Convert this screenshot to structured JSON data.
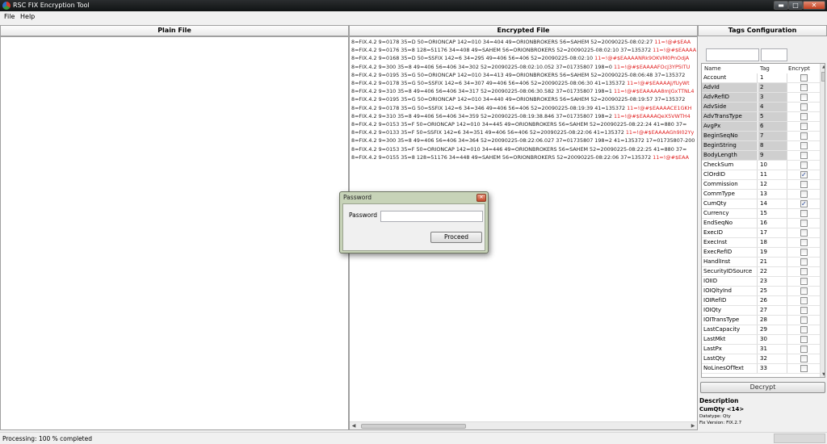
{
  "window": {
    "title": "RSC FIX Encryption Tool",
    "minimize_glyph": "▬",
    "maximize_glyph": "□",
    "close_glyph": "✕"
  },
  "menu": {
    "items": [
      "File",
      "Help"
    ]
  },
  "panels": {
    "plain_file": "Plain File",
    "encrypted_file": "Encrypted File",
    "tags_configuration": "Tags Configuration"
  },
  "encrypted_lines": [
    {
      "plain": "8=FIX.4.2 9=0178 35=D 50=ORIONCAP 142=010 34=404 49=ORIONBROKERS 56=SAHEM 52=20090225-08:02:27 ",
      "cipher": "11=!@#$EAA"
    },
    {
      "plain": "8=FIX.4.2 9=0176 35=8 128=51176 34=408 49=SAHEM 56=ORIONBROKERS 52=20090225-08:02:10 37=135372 ",
      "cipher": "11=!@#$EAAAA"
    },
    {
      "plain": "8=FIX.4.2 9=0168 35=D 50=SSFIX 142=6 34=295 49=406 56=406 52=20090225-08:02:10 ",
      "cipher": "11=!@#$EAAAANRk9OKVM0PnOdjA"
    },
    {
      "plain": "8=FIX.4.2 9=300 35=8 49=406 56=406 34=302 52=20090225-08:02:10.052 37=01735807 198=0 ",
      "cipher": "11=!@#$EAAAAFOcJ3YP5ITU"
    },
    {
      "plain": "8=FIX.4.2 9=0195 35=G 50=ORIONCAP 142=010 34=413 49=ORIONBROKERS 56=SAHEM 52=20090225-08:06:48 37=135372 ",
      "cipher": ""
    },
    {
      "plain": "8=FIX.4.2 9=0178 35=G 50=SSFIX 142=6 34=307 49=406 56=406 52=20090225-08:06:30 41=135372 ",
      "cipher": "11=!@#$EAAAAJ/fUyWt"
    },
    {
      "plain": "8=FIX.4.2 9=310 35=8 49=406 56=406 34=317 52=20090225-08:06:30.582 37=01735807 198=1 ",
      "cipher": "11=!@#$EAAAAA8mJGxTTNL4"
    },
    {
      "plain": "8=FIX.4.2 9=0195 35=G 50=ORIONCAP 142=010 34=440 49=ORIONBROKERS 56=SAHEM 52=20090225-08:19:57 37=135372 ",
      "cipher": ""
    },
    {
      "plain": "8=FIX.4.2 9=0178 35=G 50=SSFIX 142=6 34=346 49=406 56=406 52=20090225-08:19:39 41=135372 ",
      "cipher": "11=!@#$EAAAACE1GKH"
    },
    {
      "plain": "8=FIX.4.2 9=310 35=8 49=406 56=406 34=359 52=20090225-08:19:38.846 37=01735807 198=2 ",
      "cipher": "11=!@#$EAAAAQeX5VWTH4"
    },
    {
      "plain": "8=FIX.4.2 9=0153 35=F 50=ORIONCAP 142=010 34=445 49=ORIONBROKERS 56=SAHEM 52=20090225-08:22:24 41=880 37=",
      "cipher": ""
    },
    {
      "plain": "8=FIX.4.2 9=0133 35=F 50=SSFIX 142=6 34=351 49=406 56=406 52=20090225-08:22:06 41=135372 ",
      "cipher": "11=!@#$EAAAAGh9l02Yy"
    },
    {
      "plain": "8=FIX.4.2 9=300 35=8 49=406 56=406 34=364 52=20090225-08:22:06.027 37=01735807 198=2 41=135372 17=01735807-200",
      "cipher": ""
    },
    {
      "plain": "8=FIX.4.2 9=0153 35=F 50=ORIONCAP 142=010 34=446 49=ORIONBROKERS 56=SAHEM 52=20090225-08:22:25 41=880 37=",
      "cipher": ""
    },
    {
      "plain": "8=FIX.4.2 9=0155 35=8 128=51176 34=448 49=SAHEM 56=ORIONBROKERS 52=20090225-08:22:06 37=135372 ",
      "cipher": "11=!@#$EAA"
    }
  ],
  "tags_grid": {
    "headers": {
      "name": "Name",
      "tag": "Tag",
      "encrypt": "Encrypt"
    },
    "rows": [
      {
        "name": "Account",
        "tag": "1",
        "encrypt": false,
        "shaded": false
      },
      {
        "name": "AdvId",
        "tag": "2",
        "encrypt": false,
        "shaded": true
      },
      {
        "name": "AdvRefID",
        "tag": "3",
        "encrypt": false,
        "shaded": true
      },
      {
        "name": "AdvSide",
        "tag": "4",
        "encrypt": false,
        "shaded": true
      },
      {
        "name": "AdvTransType",
        "tag": "5",
        "encrypt": false,
        "shaded": true
      },
      {
        "name": "AvgPx",
        "tag": "6",
        "encrypt": false,
        "shaded": true
      },
      {
        "name": "BeginSeqNo",
        "tag": "7",
        "encrypt": false,
        "shaded": true
      },
      {
        "name": "BeginString",
        "tag": "8",
        "encrypt": false,
        "shaded": true
      },
      {
        "name": "BodyLength",
        "tag": "9",
        "encrypt": false,
        "shaded": true
      },
      {
        "name": "CheckSum",
        "tag": "10",
        "encrypt": false,
        "shaded": false
      },
      {
        "name": "ClOrdID",
        "tag": "11",
        "encrypt": true,
        "shaded": false
      },
      {
        "name": "Commission",
        "tag": "12",
        "encrypt": false,
        "shaded": false
      },
      {
        "name": "CommType",
        "tag": "13",
        "encrypt": false,
        "shaded": false
      },
      {
        "name": "CumQty",
        "tag": "14",
        "encrypt": true,
        "shaded": false
      },
      {
        "name": "Currency",
        "tag": "15",
        "encrypt": false,
        "shaded": false
      },
      {
        "name": "EndSeqNo",
        "tag": "16",
        "encrypt": false,
        "shaded": false
      },
      {
        "name": "ExecID",
        "tag": "17",
        "encrypt": false,
        "shaded": false
      },
      {
        "name": "ExecInst",
        "tag": "18",
        "encrypt": false,
        "shaded": false
      },
      {
        "name": "ExecRefID",
        "tag": "19",
        "encrypt": false,
        "shaded": false
      },
      {
        "name": "HandlInst",
        "tag": "21",
        "encrypt": false,
        "shaded": false
      },
      {
        "name": "SecurityIDSource",
        "tag": "22",
        "encrypt": false,
        "shaded": false
      },
      {
        "name": "IOIID",
        "tag": "23",
        "encrypt": false,
        "shaded": false
      },
      {
        "name": "IOIQltyInd",
        "tag": "25",
        "encrypt": false,
        "shaded": false
      },
      {
        "name": "IOIRefID",
        "tag": "26",
        "encrypt": false,
        "shaded": false
      },
      {
        "name": "IOIQty",
        "tag": "27",
        "encrypt": false,
        "shaded": false
      },
      {
        "name": "IOITransType",
        "tag": "28",
        "encrypt": false,
        "shaded": false
      },
      {
        "name": "LastCapacity",
        "tag": "29",
        "encrypt": false,
        "shaded": false
      },
      {
        "name": "LastMkt",
        "tag": "30",
        "encrypt": false,
        "shaded": false
      },
      {
        "name": "LastPx",
        "tag": "31",
        "encrypt": false,
        "shaded": false
      },
      {
        "name": "LastQty",
        "tag": "32",
        "encrypt": false,
        "shaded": false
      },
      {
        "name": "NoLinesOfText",
        "tag": "33",
        "encrypt": false,
        "shaded": false
      }
    ]
  },
  "decrypt_button": "Decrypt",
  "description": {
    "heading": "Description",
    "field": "CumQty <14>",
    "datatype": "Datatype: Qty",
    "fix_version": "Fix Version: FIX.2.7"
  },
  "status": {
    "text": "Processing: 100 % completed",
    "progress": 1.0
  },
  "password_dialog": {
    "title": "Password",
    "label": "Password",
    "password_value": "",
    "proceed_label": "Proceed"
  },
  "colors": {
    "cipher_text": "#e02020",
    "dialog_frame": "#c7d3b8",
    "titlebar": "#1b1e20"
  }
}
